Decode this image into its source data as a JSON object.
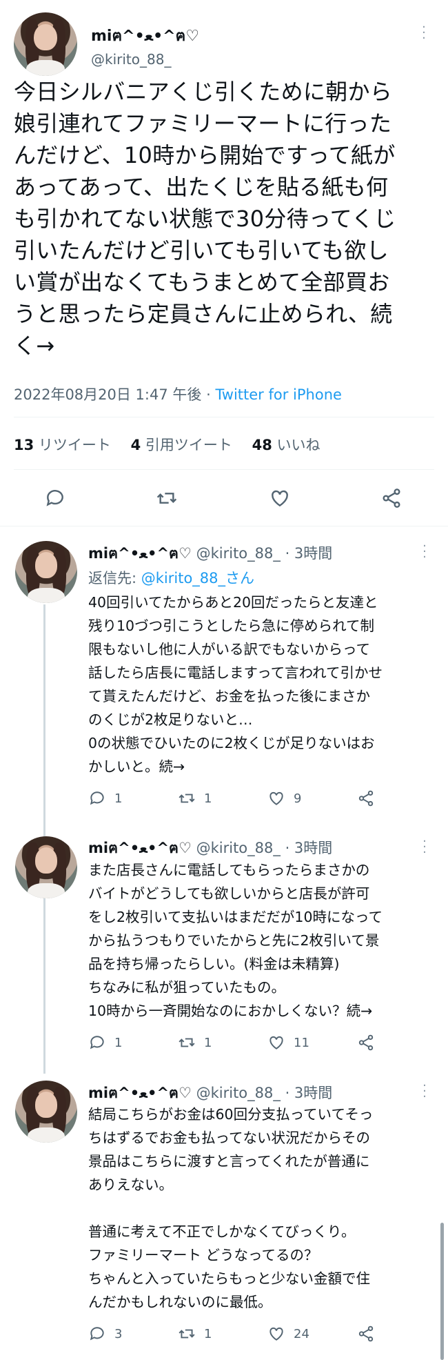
{
  "main_tweet": {
    "display_name": "miฅ^•ﻌ•^ฅ♡",
    "handle": "@kirito_88_",
    "text": "今日シルバニアくじ引くために朝から\n娘引連れてファミリーマートに行った\nんだけど、10時から開始ですって紙が\nあってあって、出たくじを貼る紙も何\nも引かれてない状態で30分待ってくじ\n引いたんだけど引いても引いても欲し\nい賞が出なくてもうまとめて全部買お\nうと思ったら定員さんに止められ、続\nく→",
    "timestamp": "2022年08月20日 1:47 午後",
    "separator": " · ",
    "source": "Twitter for iPhone",
    "stats": {
      "retweets_count": "13",
      "retweets_label": "リツイート",
      "quotes_count": "4",
      "quotes_label": "引用ツイート",
      "likes_count": "48",
      "likes_label": "いいね"
    }
  },
  "replies": [
    {
      "display_name": "miฅ^•ﻌ•^ฅ♡",
      "handle": "@kirito_88_",
      "time": " · 3時間",
      "reply_to_prefix": "返信先: ",
      "reply_to_mention": "@kirito_88_さん",
      "text": "40回引いてたからあと20回だったらと友達と\n残り10づつ引こうとしたら急に停められて制\n限もないし他に人がいる訳でもないからって\n話したら店長に電話しますって言われて引かせ\nて貰えたんだけど、お金を払った後にまさか\nのくじが2枚足りないと…\n0の状態でひいたのに2枚くじが足りないはお\nかしいと。続→",
      "replies": "1",
      "retweets": "1",
      "likes": "9"
    },
    {
      "display_name": "miฅ^•ﻌ•^ฅ♡",
      "handle": "@kirito_88_",
      "time": " · 3時間",
      "text": "また店長さんに電話してもらったらまさかの\nバイトがどうしても欲しいからと店長が許可\nをし2枚引いて支払いはまだだが10時になって\nから払うつもりでいたからと先に2枚引いて景\n品を持ち帰ったらしい。(料金は未精算)\nちなみに私が狙っていたもの。\n10時から一斉開始なのにおかしくない？続→",
      "replies": "1",
      "retweets": "1",
      "likes": "11"
    },
    {
      "display_name": "miฅ^•ﻌ•^ฅ♡",
      "handle": "@kirito_88_",
      "time": " · 3時間",
      "text": "結局こちらがお金は60回分支払っていてそっ\nちはずるでお金も払ってない状況だからその\n景品はこちらに渡すと言ってくれたが普通に\nありえない。\n\n普通に考えて不正でしかなくてびっくり。\nファミリーマート どうなってるの？\nちゃんと入っていたらもっと少ない金額で住\nんだかもしれないのに最低。",
      "replies": "3",
      "retweets": "1",
      "likes": "24"
    }
  ],
  "colors": {
    "link": "#1d9bf0",
    "secondary_text": "#536471",
    "primary_text": "#0f1419",
    "divider": "#eff3f4",
    "thread_line": "#cfd9de"
  }
}
